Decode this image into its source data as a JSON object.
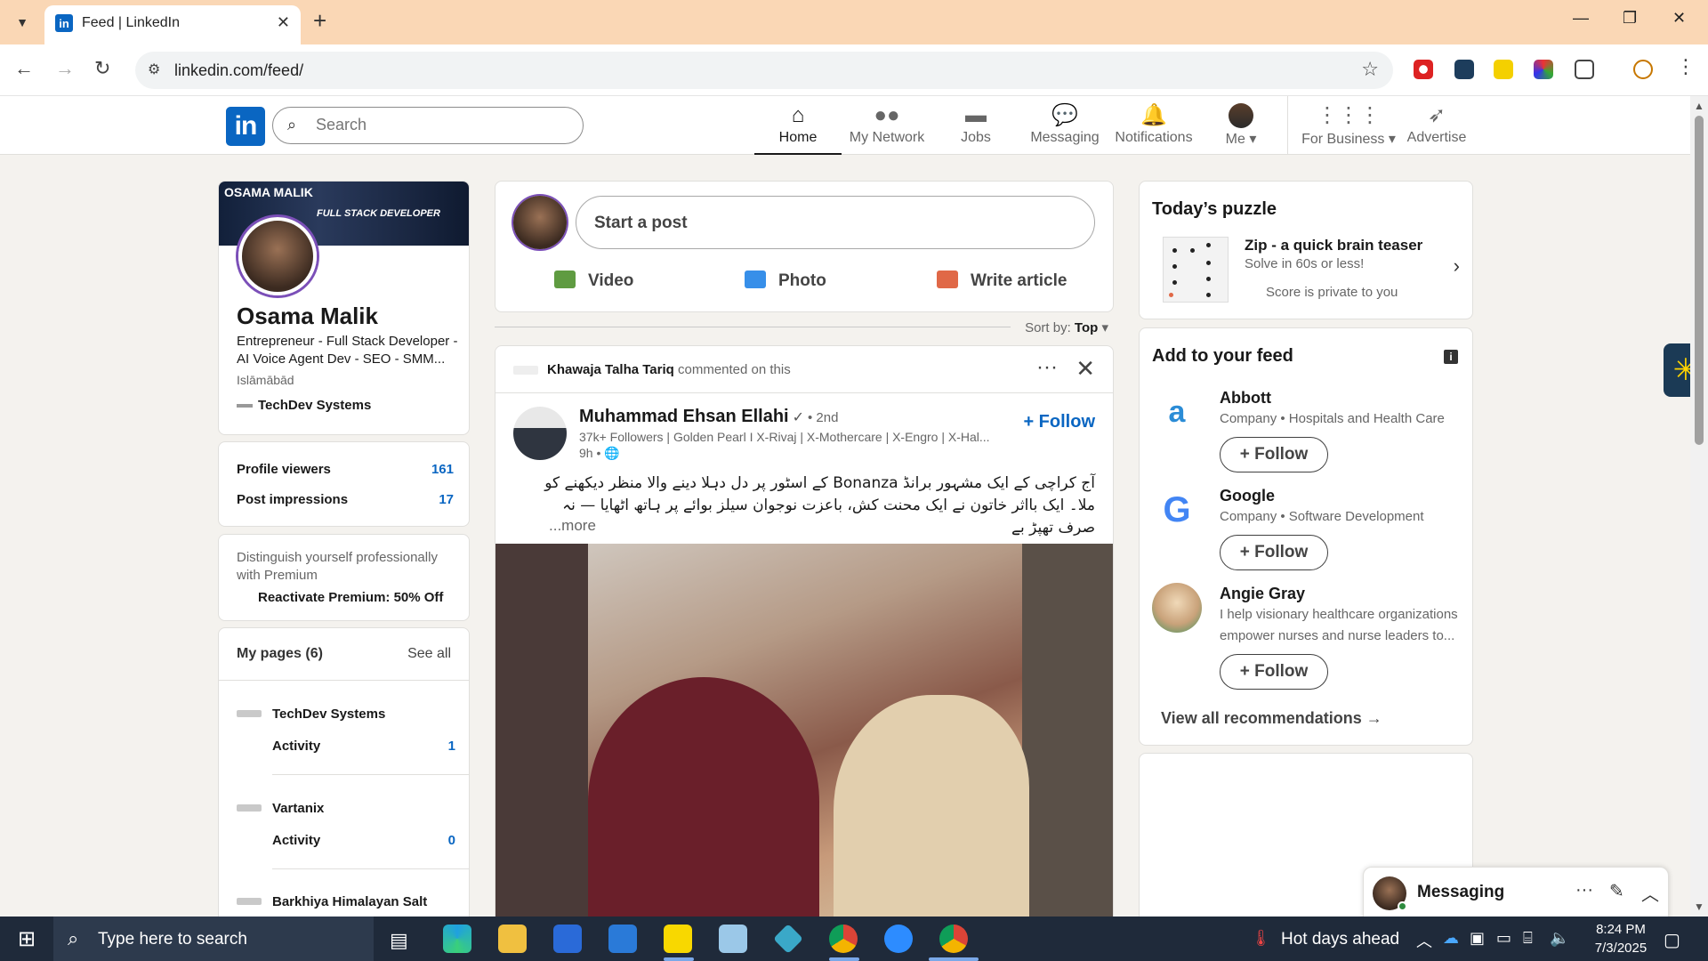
{
  "browser": {
    "tab_title": "Feed | LinkedIn",
    "url": "linkedin.com/feed/",
    "new_tab": "+",
    "tab_close": "✕"
  },
  "linkedin": {
    "logo": "in",
    "search_placeholder": "Search",
    "nav": [
      {
        "label": "Home",
        "icon": "home-icon",
        "active": true
      },
      {
        "label": "My Network",
        "icon": "network-icon"
      },
      {
        "label": "Jobs",
        "icon": "briefcase-icon"
      },
      {
        "label": "Messaging",
        "icon": "chat-icon"
      },
      {
        "label": "Notifications",
        "icon": "bell-icon"
      },
      {
        "label": "Me",
        "icon": "avatar"
      },
      {
        "label": "For Business",
        "icon": "grid-icon"
      },
      {
        "label": "Advertise",
        "icon": "compass-icon"
      }
    ]
  },
  "profile": {
    "banner_title": "OSAMA MALIK",
    "banner_sub": "FULL STACK DEVELOPER",
    "name": "Osama Malik",
    "headline": "Entrepreneur - Full Stack Developer - AI Voice Agent Dev - SEO - SMM...",
    "location": "Islāmābād",
    "company": "TechDev Systems",
    "stats": [
      {
        "label": "Profile viewers",
        "value": "161"
      },
      {
        "label": "Post impressions",
        "value": "17"
      }
    ],
    "premium_text": "Distinguish yourself professionally with Premium",
    "premium_link": "Reactivate Premium: 50% Off",
    "pages_title": "My pages (6)",
    "pages_see_all": "See all",
    "pages": [
      {
        "name": "TechDev Systems",
        "activity_label": "Activity",
        "activity": "1"
      },
      {
        "name": "Vartanix",
        "activity_label": "Activity",
        "activity": "0"
      },
      {
        "name": "Barkhiya Himalayan Salt"
      }
    ]
  },
  "composer": {
    "placeholder": "Start a post",
    "actions": [
      {
        "label": "Video",
        "color": "#378fe9"
      },
      {
        "label": "Photo",
        "color": "#5f9b41"
      },
      {
        "label": "Write article",
        "color": "#e06847"
      }
    ]
  },
  "sort": {
    "label": "Sort by:",
    "value": "Top"
  },
  "post": {
    "context_name": "Khawaja Talha Tariq",
    "context_action": "commented on this",
    "author": "Muhammad Ehsan Ellahi",
    "degree": "• 2nd",
    "meta": "37k+ Followers | Golden Pearl I X-Rivaj | X-Mothercare | X-Engro | X-Hal...",
    "time": "9h • 🌐",
    "follow": "+ Follow",
    "text": "آج کراچی کے ایک مشہور برانڈ Bonanza کے اسٹور پر دل دہلا دینے والا منظر دیکھنے کو ملا۔ ایک بااثر خاتون نے ایک محنت کش، باعزت نوجوان سیلز بوائے پر ہاتھ اٹھایا — نہ صرف تھپڑ بے",
    "more": "...more"
  },
  "puzzle": {
    "title": "Today’s puzzle",
    "name": "Zip - a quick brain teaser",
    "sub": "Solve in 60s or less!",
    "privacy": "Score is private to you"
  },
  "feed_recs": {
    "title": "Add to your feed",
    "items": [
      {
        "name": "Abbott",
        "desc": "Company • Hospitals and Health Care",
        "follow": "Follow"
      },
      {
        "name": "Google",
        "desc": "Company • Software Development",
        "follow": "Follow"
      },
      {
        "name": "Angie Gray",
        "desc": "I help visionary healthcare organizations empower nurses and nurse leaders to...",
        "follow": "Follow"
      }
    ],
    "view_all": "View all recommendations →"
  },
  "messaging": {
    "title": "Messaging"
  },
  "taskbar": {
    "search_placeholder": "Type here to search",
    "weather": "Hot days ahead",
    "time": "8:24 PM",
    "date": "7/3/2025"
  }
}
